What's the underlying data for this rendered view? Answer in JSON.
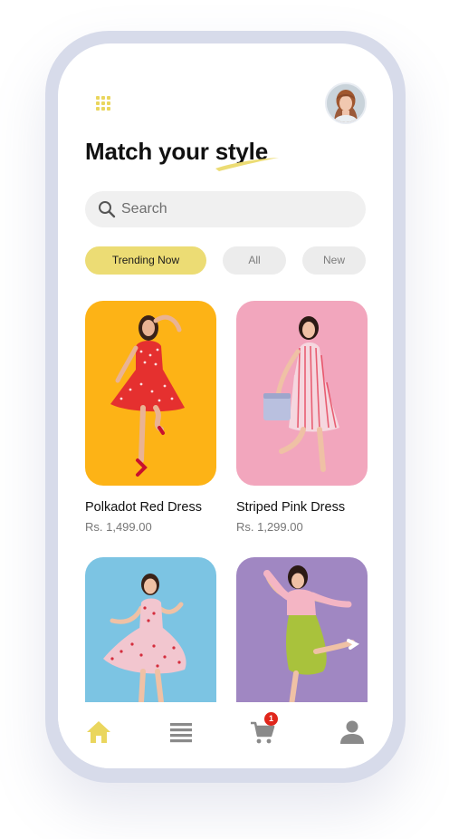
{
  "header": {
    "title": "Match your style",
    "menu_icon": "grid-icon",
    "avatar_icon": "user-avatar"
  },
  "search": {
    "placeholder": "Search",
    "icon": "search-icon"
  },
  "filters": [
    {
      "label": "Trending Now",
      "active": true
    },
    {
      "label": "All",
      "active": false
    },
    {
      "label": "New",
      "active": false
    }
  ],
  "products": [
    {
      "name": "Polkadot Red Dress",
      "price": "Rs.  1,499.00",
      "bg": "#fdb316",
      "dress": "#e5302f"
    },
    {
      "name": "Striped Pink Dress",
      "price": "Rs.  1,299.00",
      "bg": "#f2a6bd",
      "dress": "#f5d7df"
    },
    {
      "name": "",
      "price": "",
      "bg": "#7cc4e3",
      "dress": "#f2c6cf"
    },
    {
      "name": "",
      "price": "",
      "bg": "#a087c2",
      "dress": "#a9c23c"
    }
  ],
  "bottom_nav": {
    "items": [
      "home-icon",
      "list-icon",
      "cart-icon",
      "profile-icon"
    ],
    "cart_badge": "1"
  },
  "colors": {
    "accent": "#ecdc74",
    "frame": "#d7dbea",
    "badge": "#e0261b"
  }
}
